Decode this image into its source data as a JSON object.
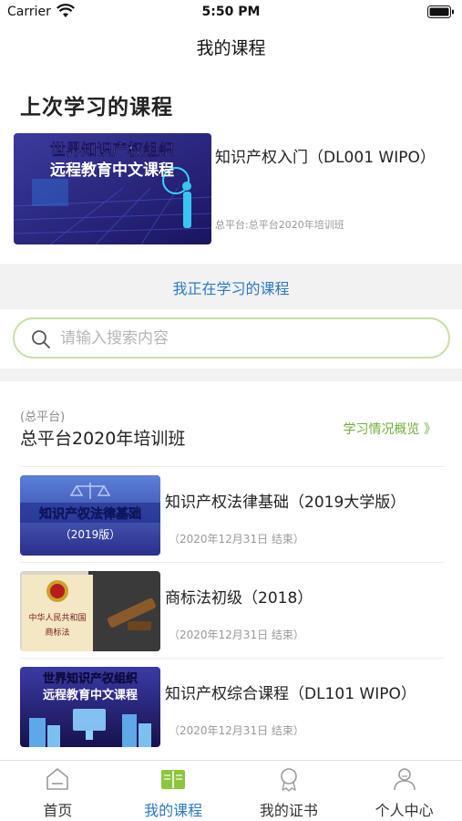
{
  "status_bar": {
    "carrier": "Carrier",
    "time": "5:50 PM"
  },
  "nav": {
    "title": "我的课程"
  },
  "last_course": {
    "section_title": "上次学习的课程",
    "name": "知识产权入门（DL001 WIPO）",
    "platform_class": "总平台:总平台2020年培训班",
    "thumb_text": [
      "世界知识产权组织",
      "远程教育中文课程"
    ]
  },
  "learning_link": "我正在学习的课程",
  "search": {
    "placeholder": "请输入搜索内容"
  },
  "class_section": {
    "platform": "(总平台)",
    "name": "总平台2020年培训班",
    "overview": "学习情况概览 》"
  },
  "courses": [
    {
      "name": "知识产权法律基础（2019大学版）",
      "date": "（2020年12月31日 结束）",
      "thumb_text": [
        "知识产权法律基础",
        "（2019版）"
      ]
    },
    {
      "name": "商标法初级（2018）",
      "date": "（2020年12月31日 结束）",
      "thumb_text": [
        "中华人民共和国",
        "商标法"
      ]
    },
    {
      "name": "知识产权综合课程（DL101 WIPO）",
      "date": "（2020年12月31日 结束）",
      "thumb_text": [
        "世界知识产权组织",
        "远程教育中文课程"
      ]
    }
  ],
  "tabs": [
    {
      "label": "首页",
      "icon": "home-icon",
      "active": false
    },
    {
      "label": "我的课程",
      "icon": "book-icon",
      "active": true
    },
    {
      "label": "我的证书",
      "icon": "certificate-icon",
      "active": false
    },
    {
      "label": "个人中心",
      "icon": "user-icon",
      "active": false
    }
  ],
  "colors": {
    "accent": "#2c78c4",
    "green": "#6fae3f",
    "search_border": "#c7e0a4"
  }
}
